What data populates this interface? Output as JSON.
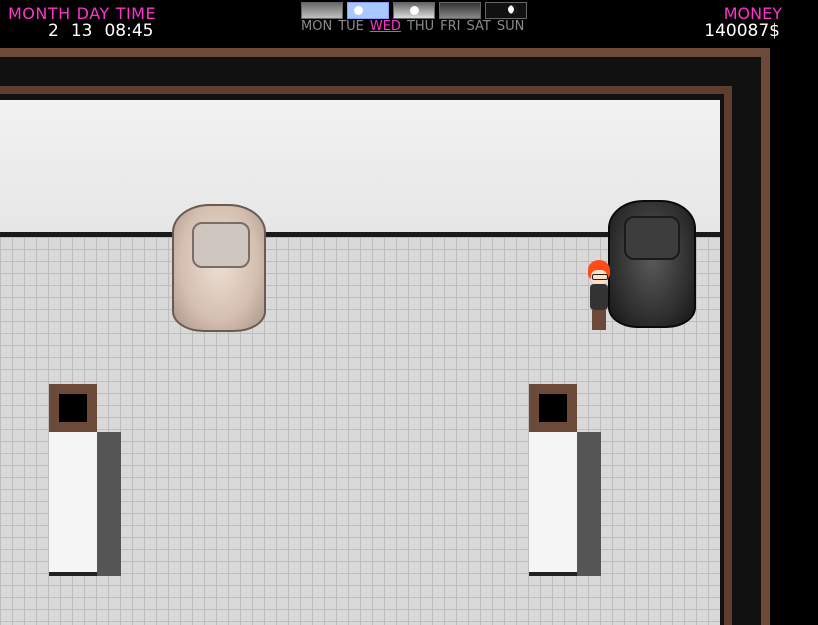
{
  "hud": {
    "labels": {
      "month": "MONTH",
      "day": "DAY",
      "time": "TIME",
      "money": "MONEY"
    },
    "values": {
      "month": "2",
      "day": "13",
      "time": "08:45",
      "money": "140087$"
    }
  },
  "time_of_day_icons": [
    "dawn-icon",
    "morning-icon",
    "afternoon-icon",
    "evening-icon",
    "night-icon"
  ],
  "week": {
    "days": [
      "MON",
      "TUE",
      "WED",
      "THU",
      "FRI",
      "SAT",
      "SUN"
    ],
    "current": "WED"
  },
  "colors": {
    "label": "#ff33cc",
    "value": "#ffffff",
    "day_inactive": "#8a8a8a",
    "wall_trim": "#6b4a3a",
    "floor": "#d9d9d9"
  }
}
